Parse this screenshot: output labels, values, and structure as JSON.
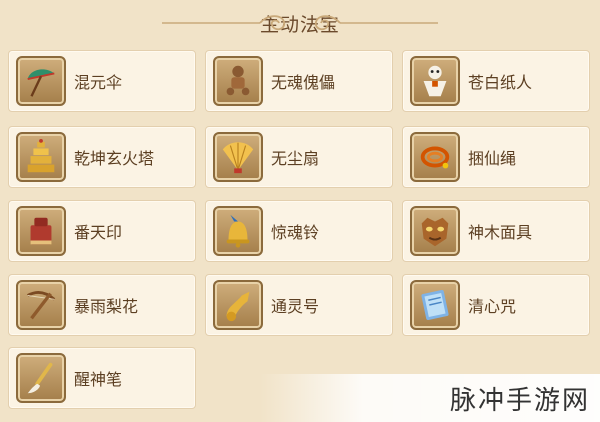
{
  "header": {
    "title": "主动法宝"
  },
  "items": [
    {
      "label": "混元伞",
      "icon": "umbrella-icon"
    },
    {
      "label": "无魂傀儡",
      "icon": "puppet-icon"
    },
    {
      "label": "苍白纸人",
      "icon": "paper-doll-icon"
    },
    {
      "label": "乾坤玄火塔",
      "icon": "pagoda-icon"
    },
    {
      "label": "无尘扇",
      "icon": "fan-icon"
    },
    {
      "label": "捆仙绳",
      "icon": "rope-icon"
    },
    {
      "label": "番天印",
      "icon": "seal-icon"
    },
    {
      "label": "惊魂铃",
      "icon": "bell-icon"
    },
    {
      "label": "神木面具",
      "icon": "mask-icon"
    },
    {
      "label": "暴雨梨花",
      "icon": "crossbow-icon"
    },
    {
      "label": "通灵号",
      "icon": "horn-icon"
    },
    {
      "label": "清心咒",
      "icon": "scroll-icon"
    },
    {
      "label": "醒神笔",
      "icon": "brush-icon"
    }
  ],
  "watermark": {
    "text": "脉冲手游网"
  },
  "colors": {
    "card_bg": "#fbf3e4",
    "panel_bg": "#f1e3c8",
    "text": "#5c3f22"
  }
}
